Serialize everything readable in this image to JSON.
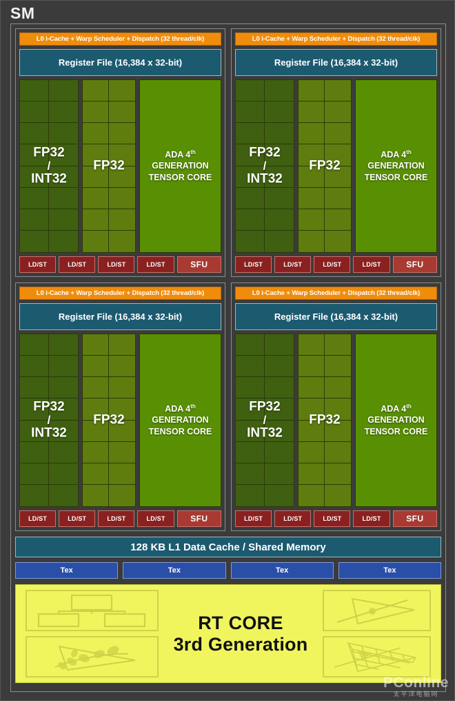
{
  "diagram": {
    "title": "SM",
    "partition": {
      "scheduler_label": "L0 i-Cache + Warp Scheduler + Dispatch (32 thread/clk)",
      "register_file_label": "Register File (16,384 x 32-bit)",
      "fp32_int32_label_line1": "FP32",
      "fp32_int32_label_line2": "/",
      "fp32_int32_label_line3": "INT32",
      "fp32_label": "FP32",
      "tensor_core_line1_prefix": "ADA 4",
      "tensor_core_line1_sup": "th",
      "tensor_core_line2": "GENERATION",
      "tensor_core_line3": "TENSOR CORE",
      "ldst_label": "LD/ST",
      "sfu_label": "SFU",
      "ldst_count": 4
    },
    "partitions": [
      {
        "id": "partition-top-left"
      },
      {
        "id": "partition-top-right"
      },
      {
        "id": "partition-bottom-left"
      },
      {
        "id": "partition-bottom-right"
      }
    ],
    "l1_cache_label": "128 KB L1 Data Cache / Shared Memory",
    "tex_label": "Tex",
    "tex_count": 4,
    "rt_core": {
      "line1": "RT CORE",
      "line2": "3rd Generation",
      "icons": [
        {
          "name": "bvh-tree-icon",
          "position": "top-left"
        },
        {
          "name": "ray-triangle-intersection-icon",
          "position": "top-right"
        },
        {
          "name": "alpha-foliage-triangle-icon",
          "position": "bottom-left"
        },
        {
          "name": "micro-mesh-triangle-icon",
          "position": "bottom-right"
        }
      ]
    },
    "watermark": {
      "main": "PConline",
      "sub": "太平洋电脑网"
    },
    "colors": {
      "background": "#3b3b3b",
      "frame_border": "#8d8d8d",
      "scheduler_orange": "#f08c0c",
      "register_file_teal": "#1c5a70",
      "fp32_int32_green": "#3f6010",
      "fp32_green": "#5e7d0e",
      "tensor_core_green": "#599003",
      "ldst_red": "#8a2120",
      "sfu_red": "#a83a32",
      "tex_blue": "#2a4fa8",
      "rt_core_yellow": "#f0f55e",
      "cell_border": "#2b3a06",
      "text_white": "#ffffff",
      "text_black": "#111111"
    }
  }
}
